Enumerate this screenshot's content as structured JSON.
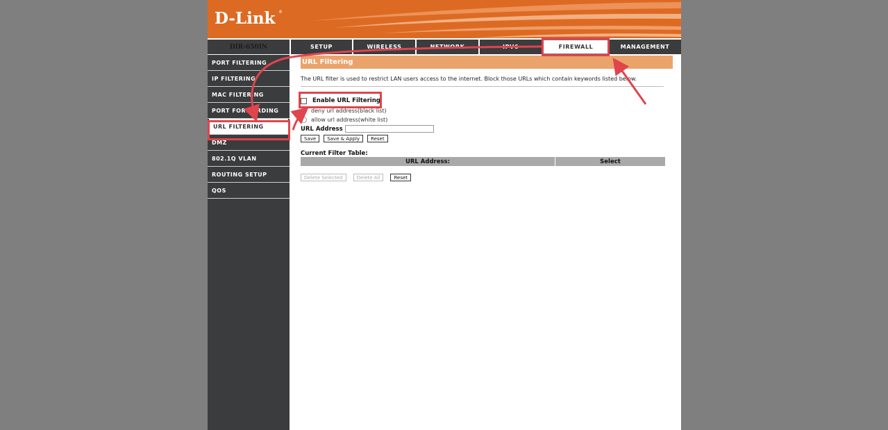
{
  "header": {
    "brand": "D-Link",
    "model": "DIR-650IN"
  },
  "topnav": [
    {
      "label": "SETUP"
    },
    {
      "label": "WIRELESS"
    },
    {
      "label": "NETWORK"
    },
    {
      "label": "IPV6"
    },
    {
      "label": "FIREWALL"
    },
    {
      "label": "MANAGEMENT"
    }
  ],
  "sidebar": [
    {
      "label": "PORT FILTERING"
    },
    {
      "label": "IP FILTERING"
    },
    {
      "label": "MAC FILTERING"
    },
    {
      "label": "PORT FORWARDING"
    },
    {
      "label": "URL FILTERING"
    },
    {
      "label": "DMZ"
    },
    {
      "label": "802.1Q VLAN"
    },
    {
      "label": "ROUTING SETUP"
    },
    {
      "label": "QOS"
    }
  ],
  "main": {
    "title": "URL Filtering",
    "description": "The URL filter is used to restrict LAN users access to the internet. Block those URLs which contain keywords listed below.",
    "enable_label": "Enable URL Filtering",
    "deny_label": "deny url address(black list)",
    "allow_label": "allow url address(white list)",
    "url_label": "URL Address",
    "url_value": "",
    "buttons": {
      "save": "Save",
      "save_apply": "Save & Apply",
      "reset": "Reset"
    },
    "table_title": "Current Filter Table:",
    "table_headers": {
      "url": "URL Address:",
      "select": "Select"
    },
    "table_buttons": {
      "delete_selected": "Delete Selected",
      "delete_all": "Delete All",
      "reset": "Reset"
    }
  },
  "colors": {
    "orange": "#dd6a23",
    "nav": "#3b3c3e",
    "title_bar": "#eba36c",
    "annotation": "#e0444c"
  }
}
